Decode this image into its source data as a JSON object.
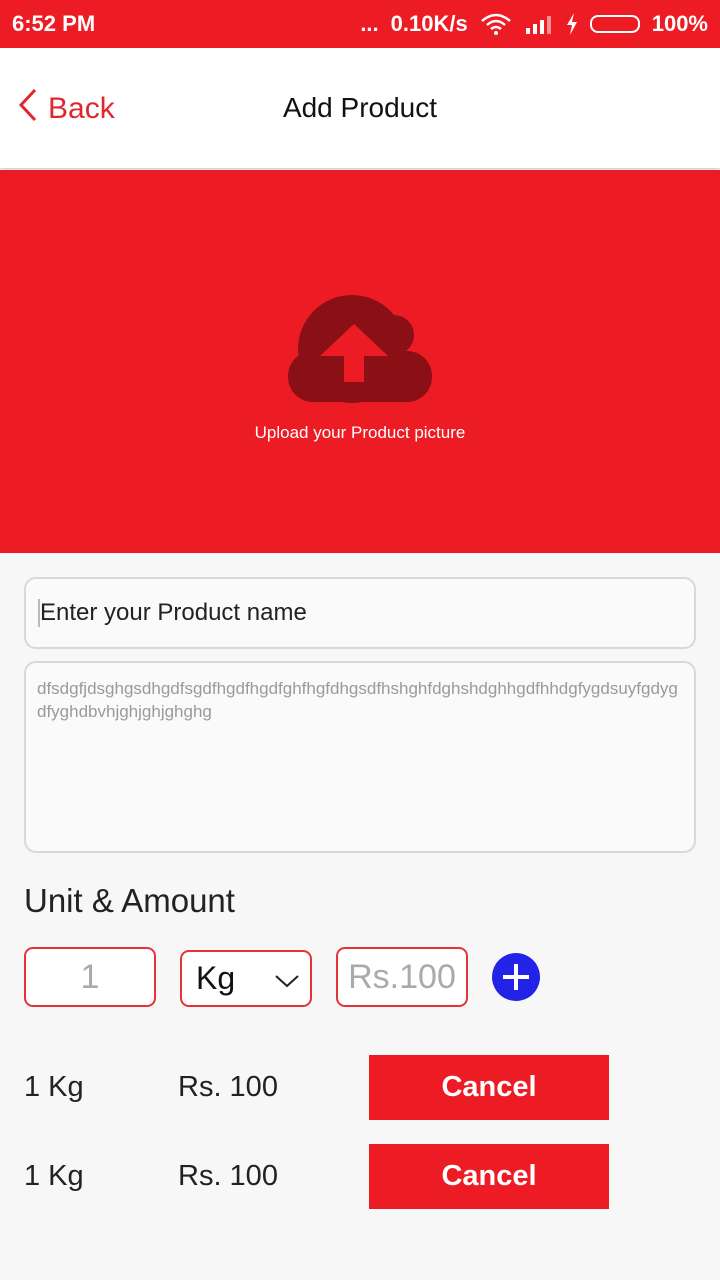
{
  "status_bar": {
    "time": "6:52 PM",
    "dots": "...",
    "speed": "0.10K/s",
    "battery": "100%",
    "icons": [
      "wifi-icon",
      "signal-icon",
      "charging-icon",
      "battery-icon"
    ]
  },
  "header": {
    "back_label": "Back",
    "title": "Add Product"
  },
  "upload": {
    "label": "Upload your Product picture",
    "icon": "cloud-upload-icon"
  },
  "form": {
    "name_placeholder": "Enter your Product name",
    "description_value": "dfsdgfjdsghgsdhgdfsgdfhgdfhgdfghfhgfdhgsdfhshghfdghshdghhgdfhhdgfygdsuyfgdygdfyghdbvhjghjghjghghg"
  },
  "unit_section": {
    "title": "Unit & Amount",
    "quantity_placeholder": "1",
    "unit_selected": "Kg",
    "price_placeholder": "Rs.100",
    "add_icon": "plus-icon"
  },
  "entries": [
    {
      "unit": "1 Kg",
      "price": "Rs. 100",
      "action": "Cancel"
    },
    {
      "unit": "1 Kg",
      "price": "Rs. 100",
      "action": "Cancel"
    }
  ],
  "colors": {
    "primary": "#ed1c24",
    "accent_blue": "#2323e8",
    "cloud": "#8b1016"
  }
}
